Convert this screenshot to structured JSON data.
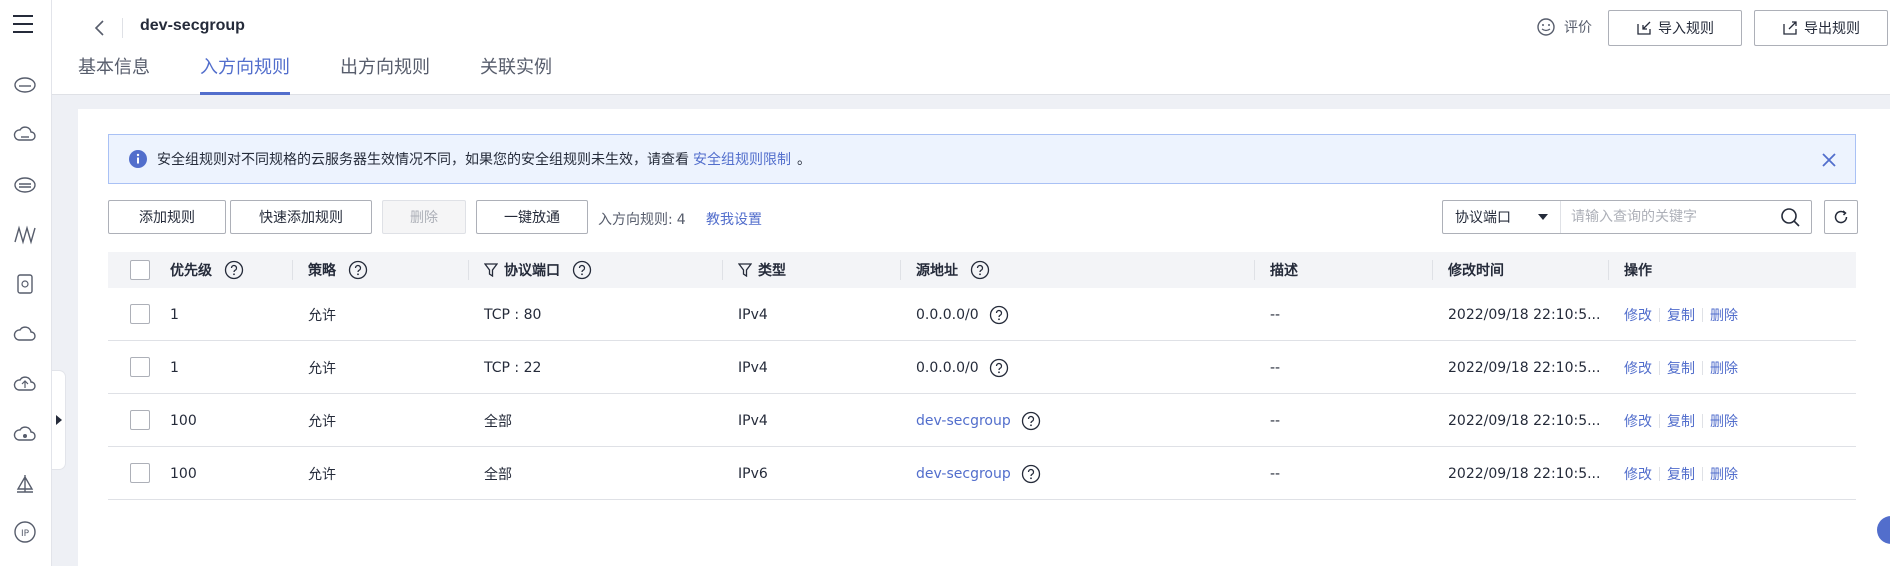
{
  "header": {
    "title": "dev-secgroup",
    "tabs": [
      {
        "label": "基本信息"
      },
      {
        "label": "入方向规则"
      },
      {
        "label": "出方向规则"
      },
      {
        "label": "关联实例"
      }
    ],
    "rate_label": "评价",
    "import_label": "导入规则",
    "export_label": "导出规则"
  },
  "notice": {
    "text": "安全组规则对不同规格的云服务器生效情况不同，如果您的安全组规则未生效，请查看",
    "link": "安全组规则限制",
    "tail": "。"
  },
  "toolbar": {
    "add": "添加规则",
    "quick_add": "快速添加规则",
    "delete": "删除",
    "one_click": "一键放通",
    "rule_count_label": "入方向规则:",
    "rule_count": "4",
    "teach": "教我设置"
  },
  "search": {
    "selected": "协议端口",
    "placeholder": "请输入查询的关键字"
  },
  "table": {
    "headers": {
      "priority": "优先级",
      "policy": "策略",
      "protocol": "协议端口",
      "type": "类型",
      "source": "源地址",
      "desc": "描述",
      "modified": "修改时间",
      "ops": "操作"
    },
    "rows": [
      {
        "priority": "1",
        "policy": "允许",
        "protocol": "TCP : 80",
        "type": "IPv4",
        "source": "0.0.0.0/0",
        "source_is_link": false,
        "desc": "--",
        "modified": "2022/09/18 22:10:5..."
      },
      {
        "priority": "1",
        "policy": "允许",
        "protocol": "TCP : 22",
        "type": "IPv4",
        "source": "0.0.0.0/0",
        "source_is_link": false,
        "desc": "--",
        "modified": "2022/09/18 22:10:5..."
      },
      {
        "priority": "100",
        "policy": "允许",
        "protocol": "全部",
        "type": "IPv4",
        "source": "dev-secgroup",
        "source_is_link": true,
        "desc": "--",
        "modified": "2022/09/18 22:10:5..."
      },
      {
        "priority": "100",
        "policy": "允许",
        "protocol": "全部",
        "type": "IPv6",
        "source": "dev-secgroup",
        "source_is_link": true,
        "desc": "--",
        "modified": "2022/09/18 22:10:5..."
      }
    ],
    "op_labels": {
      "edit": "修改",
      "copy": "复制",
      "delete": "删除"
    }
  },
  "colors": {
    "accent": "#526ecc",
    "border": "#adb0b8",
    "text": "#252b3a"
  },
  "icons": [
    "menu-icon",
    "back-icon",
    "smile-icon",
    "import-icon",
    "export-icon",
    "info-icon",
    "close-icon",
    "search-icon",
    "refresh-icon",
    "help-icon",
    "filter-icon"
  ]
}
